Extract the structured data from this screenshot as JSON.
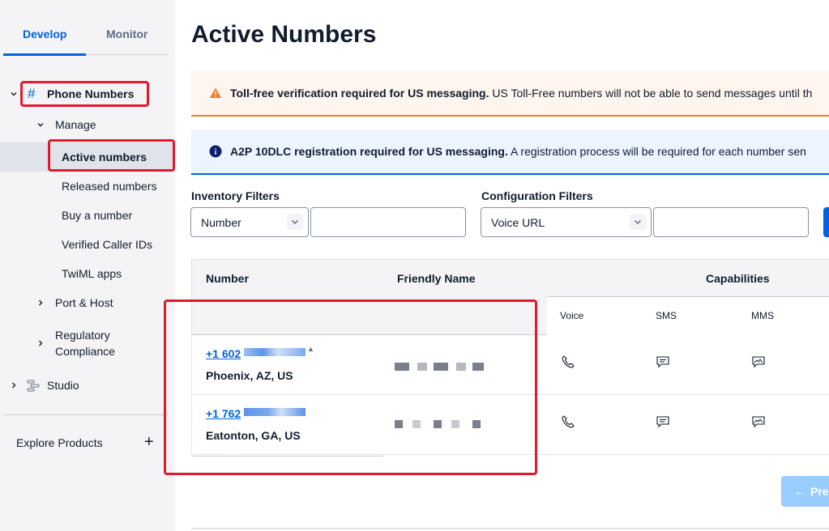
{
  "sidebar": {
    "tabs": [
      {
        "label": "Develop",
        "active": true
      },
      {
        "label": "Monitor",
        "active": false
      }
    ],
    "phone_numbers": "Phone Numbers",
    "manage": "Manage",
    "items": [
      "Active numbers",
      "Released numbers",
      "Buy a number",
      "Verified Caller IDs",
      "TwiML apps"
    ],
    "port_host": "Port & Host",
    "regulatory_line1": "Regulatory",
    "regulatory_line2": "Compliance",
    "studio": "Studio",
    "explore": "Explore Products",
    "explore_plus": "+"
  },
  "page": {
    "title": "Active Numbers"
  },
  "alerts": {
    "warning_bold": "Toll-free verification required for US messaging.",
    "warning_text": " US Toll-Free numbers will not be able to send messages until th",
    "info_bold": "A2P 10DLC registration required for US messaging.",
    "info_text": " A registration process will be required for each number sen"
  },
  "filters": {
    "inventory_label": "Inventory Filters",
    "inventory_select": "Number",
    "inventory_value": "",
    "configuration_label": "Configuration Filters",
    "configuration_select": "Voice URL",
    "configuration_value": ""
  },
  "table": {
    "headers": {
      "number": "Number",
      "friendly_name": "Friendly Name",
      "capabilities": "Capabilities",
      "voice": "Voice",
      "sms": "SMS",
      "mms": "MMS"
    },
    "rows": [
      {
        "number": "+1 602",
        "location": "Phoenix, AZ, US"
      },
      {
        "number": "+1 762",
        "location": "Eatonton, GA, US"
      }
    ]
  },
  "pagination": {
    "prev_label": "Pre"
  },
  "colors": {
    "accent": "#0263e0",
    "highlight_box": "#e3192f",
    "warning": "#f47c22"
  },
  "icons": [
    "hash-icon",
    "chevron-down-icon",
    "chevron-right-icon",
    "studio-icon",
    "warning-icon",
    "info-icon",
    "phone-icon",
    "sms-icon",
    "mms-icon",
    "arrow-left-icon"
  ]
}
